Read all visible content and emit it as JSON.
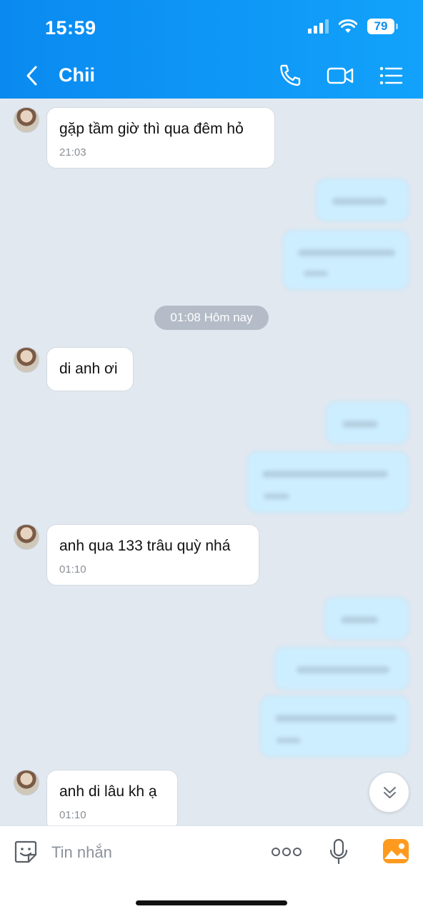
{
  "status_bar": {
    "time": "15:59",
    "battery": "79"
  },
  "header": {
    "contact_name": "Chii"
  },
  "messages": [
    {
      "direction": "in",
      "text": "gặp tầm giờ thì qua đêm hỏ",
      "time": "21:03"
    },
    {
      "direction": "in",
      "text": "di anh ơi",
      "time": ""
    },
    {
      "direction": "in",
      "text": "anh qua 133 trâu quỳ nhá",
      "time": "01:10"
    },
    {
      "direction": "in",
      "text": "anh di lâu kh ạ",
      "time": "01:10"
    }
  ],
  "divider": {
    "label": "01:08 Hôm nay"
  },
  "input": {
    "placeholder": "Tin nhắn"
  },
  "colors": {
    "accent": "#0a8af0",
    "outgoing_bubble": "#cdeeff",
    "background": "#e2e8f0"
  }
}
